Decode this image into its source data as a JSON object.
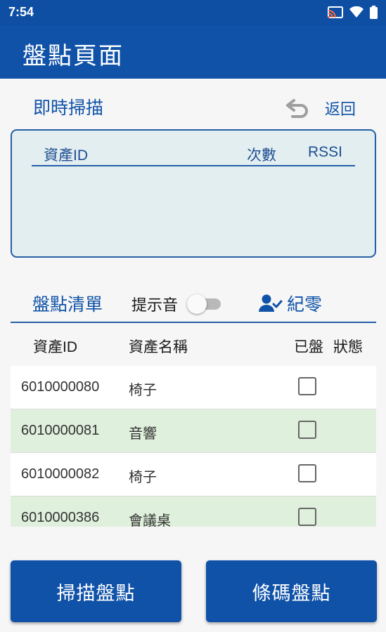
{
  "status_bar": {
    "time": "7:54",
    "icons": [
      "cast-icon",
      "wifi-icon",
      "battery-icon"
    ]
  },
  "app_bar": {
    "title": "盤點頁面"
  },
  "scan_section": {
    "title": "即時掃描",
    "back_label": "返回",
    "columns": {
      "asset_id": "資產ID",
      "count": "次數",
      "rssi": "RSSI"
    }
  },
  "inventory_section": {
    "title": "盤點清單",
    "sound_label": "提示音",
    "sound_on": false,
    "zero_label": "紀零"
  },
  "table": {
    "headers": {
      "asset_id": "資產ID",
      "asset_name": "資產名稱",
      "checked": "已盤",
      "status": "狀態"
    },
    "rows": [
      {
        "asset_id": "6010000080",
        "asset_name": "椅子",
        "checked": false
      },
      {
        "asset_id": "6010000081",
        "asset_name": "音響",
        "checked": false
      },
      {
        "asset_id": "6010000082",
        "asset_name": "椅子",
        "checked": false
      },
      {
        "asset_id": "6010000386",
        "asset_name": "會議桌",
        "checked": false
      }
    ]
  },
  "buttons": {
    "scan_inventory": "掃描盤點",
    "barcode_inventory": "條碼盤點"
  },
  "colors": {
    "primary": "#0f52a8",
    "row_alt": "#dff0dc",
    "scan_box": "#e3eef0"
  }
}
